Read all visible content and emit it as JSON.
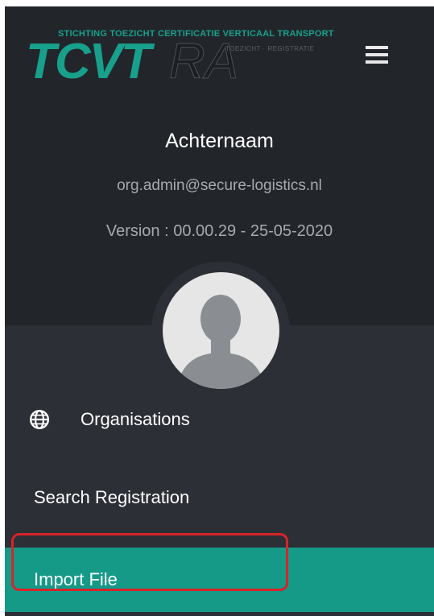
{
  "logo": {
    "org_line": "STICHTING TOEZICHT CERTIFICATIE VERTICAAL TRANSPORT",
    "primary": "TCVT",
    "secondary": "RA",
    "tagline": "TOEZICHT · REGISTRATIE"
  },
  "header": {
    "menu_icon": "hamburger-menu-icon"
  },
  "user": {
    "name": "Achternaam",
    "email": "org.admin@secure-logistics.nl",
    "version": "Version : 00.00.29 - 25-05-2020",
    "avatar_icon": "user-silhouette-icon"
  },
  "menu": {
    "items": [
      {
        "label": "Organisations",
        "icon": "globe-icon"
      },
      {
        "label": "Search Registration"
      },
      {
        "label": "Import File",
        "active": true
      }
    ]
  },
  "colors": {
    "accent": "#159a88",
    "header_bg": "#22262b",
    "sidebar_bg": "#2c2f36",
    "annotation": "#d8232a"
  }
}
